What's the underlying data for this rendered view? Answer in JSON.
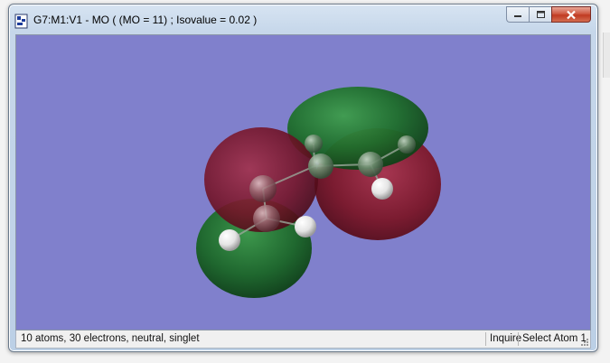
{
  "window": {
    "title": "G7:M1:V1 - MO ( (MO = 11) ; Isovalue = 0.02 )"
  },
  "titlebar_controls": {
    "minimize_icon": "minimize-icon",
    "maximize_icon": "maximize-icon",
    "close_icon": "close-icon"
  },
  "viewport": {
    "background_color": "#8080cc",
    "orbital_colors": {
      "positive_lobe": "#1f7a30",
      "negative_lobe": "#8a1a2a"
    },
    "atom_colors": {
      "carbon": "#5d7a5e",
      "hydrogen": "#f0f0f0"
    }
  },
  "status": {
    "info": "10 atoms, 30 electrons, neutral, singlet",
    "mode": "Inquire",
    "action": "Select Atom 1"
  }
}
